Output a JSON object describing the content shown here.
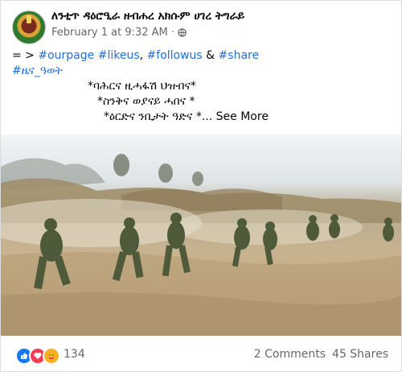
{
  "post": {
    "page_name": "ለንቲጥ ዳዕሮዒራ ዘብሐረ አክሱም ሀገረ ትግራይ",
    "date": "February 1 at 9:32 AM",
    "dot": "·"
  },
  "caption": {
    "prefix": "= > ",
    "tags": [
      "#ourpage",
      "#likeus",
      "#followus",
      "#share"
    ],
    "sep": ", ",
    "amp": " & ",
    "tag2": "#ዜና_ዓወት",
    "line3": "*ባሕርና ዚሓፋሽ ህዝብና*",
    "line4": "*ስንቅና ወያናይ ሓበና *",
    "line5": "*ዕርድና ንቢታት ዓድና *",
    "see_more": "... See More"
  },
  "footer": {
    "reaction_icons": [
      "like-icon",
      "love-icon",
      "care-icon"
    ],
    "reaction_count": "134",
    "comments": "2 Comments",
    "shares": "45 Shares"
  }
}
